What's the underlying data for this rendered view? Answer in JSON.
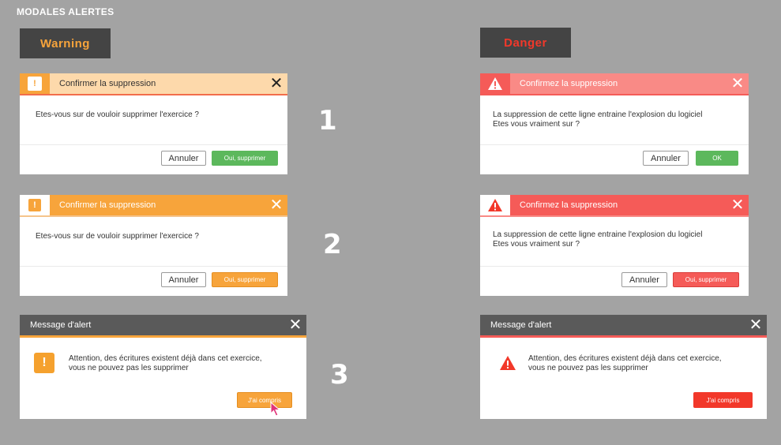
{
  "page_title": "MODALES ALERTES",
  "variants": {
    "warning_label": "Warning",
    "danger_label": "Danger"
  },
  "colors": {
    "warning_accent": "#f7a43b",
    "warning_light": "#fdd9ab",
    "warning_line": "#f26d4b",
    "danger_accent": "#f55b58",
    "danger_light": "#f98a86",
    "danger_button": "#f2382a",
    "success_button": "#5cb85c",
    "dark_header": "#5a5a5a"
  },
  "steps": [
    "1",
    "2",
    "3"
  ],
  "warning": {
    "m1": {
      "title": "Confirmer la suppression",
      "body": "Etes-vous sur de vouloir supprimer l'exercice ?",
      "cancel": "Annuler",
      "confirm": "Oui, supprimer",
      "icon": "exclamation-icon"
    },
    "m2": {
      "title": "Confirmer la suppression",
      "body": "Etes-vous sur de vouloir supprimer l'exercice ?",
      "cancel": "Annuler",
      "confirm": "Oui, supprimer",
      "icon": "exclamation-icon"
    },
    "m3": {
      "title": "Message d'alert",
      "body_line1": "Attention, des écritures existent déjà dans cet exercice,",
      "body_line2": "vous ne pouvez pas les supprimer",
      "ok": "J'ai compris",
      "icon": "exclamation-icon"
    }
  },
  "danger": {
    "m1": {
      "title": "Confirmez la suppression",
      "body_line1": "La suppression de cette ligne entraine l'explosion du logiciel",
      "body_line2": "Etes vous vraiment sur ?",
      "cancel": "Annuler",
      "confirm": "OK",
      "icon": "warning-triangle-icon"
    },
    "m2": {
      "title": "Confirmez la suppression",
      "body_line1": "La suppression de cette ligne entraine l'explosion du logiciel",
      "body_line2": "Etes vous vraiment sur ?",
      "cancel": "Annuler",
      "confirm": "Oui, supprimer",
      "icon": "warning-triangle-icon"
    },
    "m3": {
      "title": "Message d'alert",
      "body_line1": "Attention, des écritures existent déjà dans cet exercice,",
      "body_line2": "vous ne pouvez pas les supprimer",
      "ok": "J'ai compris",
      "icon": "warning-triangle-icon"
    }
  }
}
